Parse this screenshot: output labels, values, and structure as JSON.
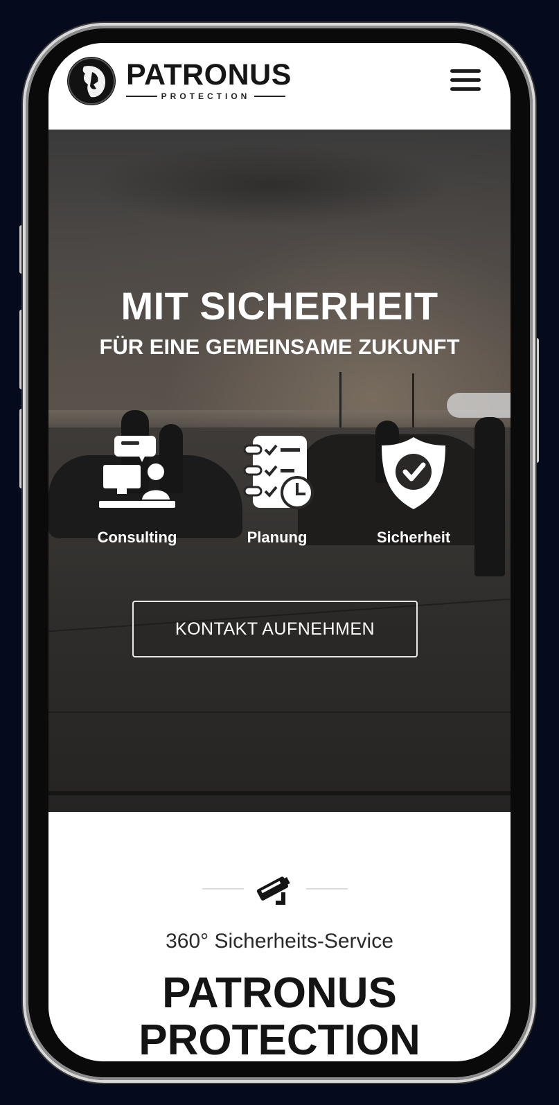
{
  "header": {
    "brand_name": "PATRONUS",
    "brand_sub": "PROTECTION",
    "menu_icon": "hamburger-menu-icon"
  },
  "hero": {
    "title": "MIT SICHERHEIT",
    "subtitle": "FÜR EINE GEMEINSAME ZUKUNFT",
    "features": [
      {
        "label": "Consulting",
        "icon": "consulting-icon"
      },
      {
        "label": "Planung",
        "icon": "checklist-clock-icon"
      },
      {
        "label": "Sicherheit",
        "icon": "shield-check-icon"
      }
    ],
    "cta_label": "KONTAKT AUFNEHMEN"
  },
  "section": {
    "icon": "security-camera-icon",
    "subtitle": "360° Sicherheits-Service",
    "title_line1": "PATRONUS",
    "title_line2": "PROTECTION"
  },
  "colors": {
    "page_background": "#050b1c",
    "text_dark": "#141414",
    "hero_text": "#ffffff"
  }
}
